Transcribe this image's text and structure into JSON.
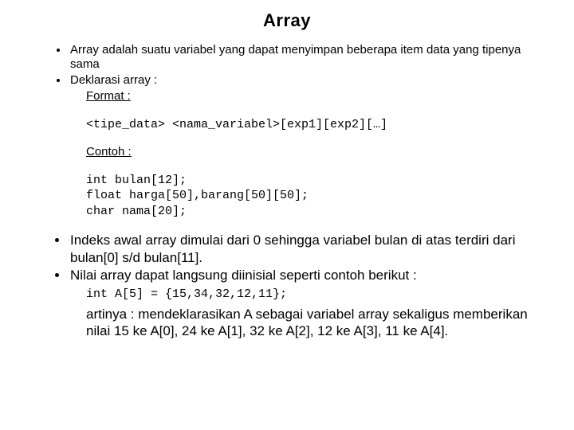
{
  "title": "Array",
  "bul1": "Array adalah suatu variabel yang dapat menyimpan beberapa item data yang tipenya sama",
  "bul2": "Deklarasi array :",
  "format_label": "Format :",
  "format_code": "<tipe_data> <nama_variabel>[exp1][exp2][…]",
  "contoh_label": "Contoh :",
  "contoh_code": "int bulan[12];\nfloat harga[50],barang[50][50];\nchar nama[20];",
  "bul3": "Indeks awal array dimulai dari 0 sehingga variabel bulan di atas terdiri dari bulan[0] s/d bulan[11].",
  "bul4": "Nilai array dapat langsung diinisial seperti contoh berikut :",
  "init_code": "int A[5] = {15,34,32,12,11};",
  "meaning": "artinya : mendeklarasikan A sebagai variabel array sekaligus memberikan nilai 15 ke A[0], 24 ke A[1], 32 ke A[2], 12 ke A[3], 11 ke A[4]."
}
